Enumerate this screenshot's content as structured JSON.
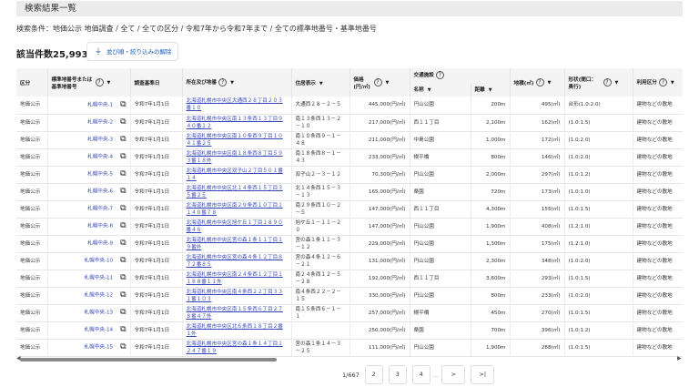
{
  "title": "検索結果一覧",
  "conditions": "検索条件：地価公示 地価調査 / 全て / 全ての区分 / 令和7年から令和7年まで / 全ての標準地番号・基準地番号",
  "count": "該当件数25,993件",
  "reset_button": "並び順・絞り込みの解除",
  "headers": {
    "kubun": "区分",
    "number": "標準地番号または基準地番号",
    "date": "調査基準日",
    "location": "所在及び地番",
    "residence": "住居表示",
    "price": "価格(円/㎡)",
    "transport": "交通施設",
    "name": "名称",
    "distance": "距離",
    "area": "地積(㎡)",
    "shape": "形状(間口：奥行)",
    "usage": "利用区分",
    "help": "?",
    "caret": "▼"
  },
  "rows": [
    [
      "地価公示",
      "札幌中央-1",
      "令和7年1月1日",
      "北海道札幌市中央区大通西２８丁目２０３番１０",
      "大通西２８－２－５",
      "445,000(円/㎡)",
      "円山公園",
      "200m",
      "495(㎡)",
      "台形(1.0:2.0)",
      "建物などの敷地"
    ],
    [
      "地価公示",
      "札幌中央-2",
      "令和7年1月1日",
      "北海道札幌市中央区南１３条西１３丁目９４０番１２",
      "南１３条西１３－２－１０",
      "217,000(円/㎡)",
      "西１１丁目",
      "2,100m",
      "162(㎡)",
      "(1.0:1.5)",
      "建物などの敷地"
    ],
    [
      "地価公示",
      "札幌中央-3",
      "令和7年1月1日",
      "北海道札幌市中央区南１０条西９丁目１０４１番２５",
      "南１０条西９－１－４８",
      "211,000(円/㎡)",
      "中島公園",
      "1,000m",
      "172(㎡)",
      "(1.0:2.0)",
      "建物などの敷地"
    ],
    [
      "地価公示",
      "札幌中央-4",
      "令和7年1月1日",
      "北海道札幌市中央区南１８条西８丁目５９３番１８外",
      "南１８条西８－１－４３",
      "233,000(円/㎡)",
      "幌平橋",
      "800m",
      "146(㎡)",
      "(1.0:2.0)",
      "建物などの敷地"
    ],
    [
      "地価公示",
      "札幌中央-5",
      "令和7年1月1日",
      "北海道札幌市中央区双子山２丁目５０１番１４",
      "双子山２－３－１２",
      "70,300(円/㎡)",
      "円山公園",
      "2,000m",
      "297(㎡)",
      "(1.0:1.2)",
      "建物などの敷地"
    ],
    [
      "地価公示",
      "札幌中央-6",
      "令和7年1月1日",
      "北海道札幌市中央区北１４条西１５丁目３５番２５",
      "北１４条西１５－３－１３",
      "165,000(円/㎡)",
      "桑園",
      "720m",
      "173(㎡)",
      "(1.0:1.0)",
      "建物などの敷地"
    ],
    [
      "地価公示",
      "札幌中央-7",
      "令和7年1月1日",
      "北海道札幌市中央区南２９条西１０丁目１１４０番７８",
      "南２９条西１０－２－５",
      "147,000(円/㎡)",
      "西１１丁目",
      "4,300m",
      "155(㎡)",
      "(1.0:1.5)",
      "建物などの敷地"
    ],
    [
      "地価公示",
      "札幌中央-8",
      "令和7年1月1日",
      "北海道札幌市中央区旭ケ丘１丁目１８９０番４６",
      "旭ケ丘１－１１－２０",
      "147,000(円/㎡)",
      "円山公園",
      "1,900m",
      "408(㎡)",
      "(1.2:1.0)",
      "建物などの敷地"
    ],
    [
      "地価公示",
      "札幌中央-9",
      "令和7年1月1日",
      "北海道札幌市中央区宮の森１条１１丁目１９番外",
      "宮の森１条１１－３－１２",
      "229,000(円/㎡)",
      "円山公園",
      "1,300m",
      "175(㎡)",
      "(1.2:1.0)",
      "建物などの敷地"
    ],
    [
      "地価公示",
      "札幌中央-10",
      "令和7年1月1日",
      "北海道札幌市中央区宮の森４条１２丁目８７２番８５",
      "宮の森４条１２－６－２１",
      "131,000(円/㎡)",
      "円山公園",
      "2,300m",
      "348(㎡)",
      "(1.0:2.0)",
      "建物などの敷地"
    ],
    [
      "地価公示",
      "札幌中央-11",
      "令和7年1月1日",
      "北海道札幌市中央区南２４条西１２丁目１１８８番１１外",
      "南２４条西１２－５－２８",
      "192,000(円/㎡)",
      "西１１丁目",
      "3,600m",
      "293(㎡)",
      "(1.0:1.5)",
      "建物などの敷地"
    ],
    [
      "地価公示",
      "札幌中央-12",
      "令和7年1月1日",
      "北海道札幌市中央区南４条西２２丁目３３１番１０３",
      "南４条西２２－２－１５",
      "330,000(円/㎡)",
      "円山公園",
      "800m",
      "233(㎡)",
      "(1.0:2.0)",
      "建物などの敷地"
    ],
    [
      "地価公示",
      "札幌中央-13",
      "令和7年1月1日",
      "北海道札幌市中央区南１５条西６丁目２７８番４７外",
      "南１５条西６－１－１",
      "257,000(円/㎡)",
      "幌平橋",
      "450m",
      "270(㎡)",
      "(1.0:1.5)",
      "建物などの敷地"
    ],
    [
      "地価公示",
      "札幌中央-14",
      "令和7年1月1日",
      "北海道札幌市中央区北６条西１８丁目２番１外",
      "",
      "250,000(円/㎡)",
      "桑園",
      "700m",
      "396(㎡)",
      "(1.0:1.2)",
      "建物などの敷地"
    ],
    [
      "地価公示",
      "札幌中央-15",
      "令和7年1月1日",
      "北海道札幌市中央区宮の森１条１４丁目１２４７番１９",
      "宮の森１条１４－３－２５",
      "111,000(円/㎡)",
      "円山公園",
      "1,900m",
      "288(㎡)",
      "(1.0:1.5)",
      "建物などの敷地"
    ]
  ],
  "pagination": {
    "current": "1/667",
    "pages": [
      "2",
      "3",
      "4"
    ],
    "ellipsis": "…",
    "next": ">",
    "last": ">|"
  }
}
